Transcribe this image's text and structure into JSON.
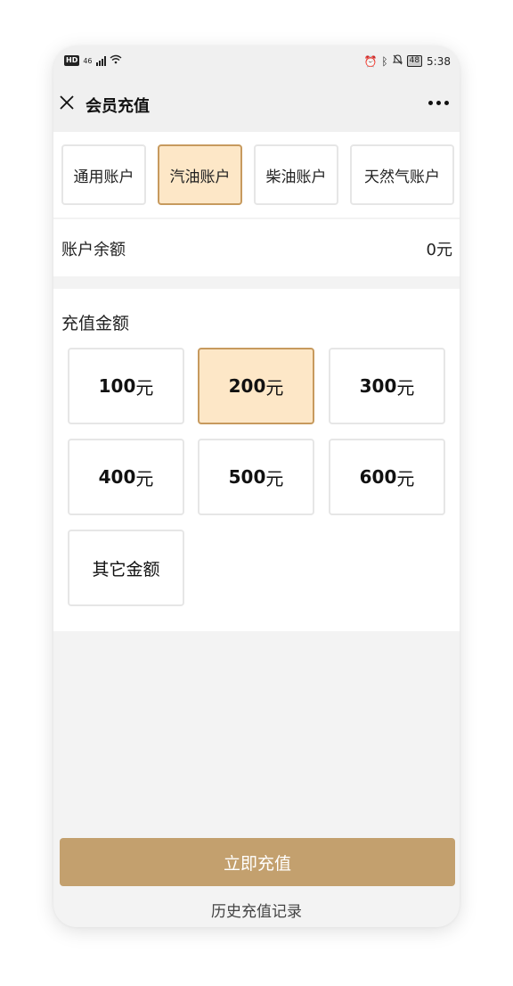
{
  "status_bar": {
    "hd": "HD",
    "network": "46",
    "battery": "48",
    "time": "5:38"
  },
  "header": {
    "title": "会员充值"
  },
  "account_tabs": [
    {
      "label": "通用账户",
      "selected": false
    },
    {
      "label": "汽油账户",
      "selected": true
    },
    {
      "label": "柴油账户",
      "selected": false
    },
    {
      "label": "天然气账户",
      "selected": false
    }
  ],
  "balance": {
    "label": "账户余额",
    "value": "0元"
  },
  "recharge": {
    "section_title": "充值金额",
    "amounts": [
      {
        "value": "100",
        "unit": "元",
        "selected": false
      },
      {
        "value": "200",
        "unit": "元",
        "selected": true
      },
      {
        "value": "300",
        "unit": "元",
        "selected": false
      },
      {
        "value": "400",
        "unit": "元",
        "selected": false
      },
      {
        "value": "500",
        "unit": "元",
        "selected": false
      },
      {
        "value": "600",
        "unit": "元",
        "selected": false
      }
    ],
    "other_label": "其它金额"
  },
  "actions": {
    "submit_label": "立即充值",
    "history_label": "历史充值记录"
  },
  "colors": {
    "accent": "#c3a06e",
    "selected_bg": "#fde7c7",
    "selected_border": "#c79a5e"
  }
}
